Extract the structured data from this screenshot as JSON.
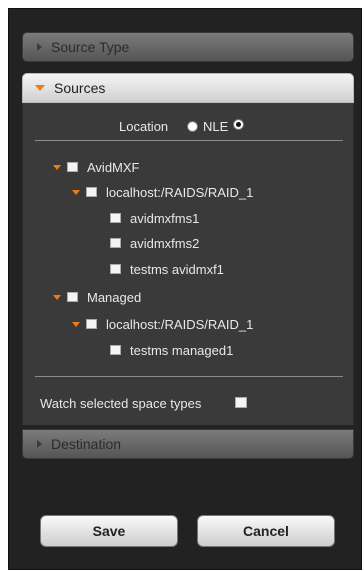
{
  "source_type": {
    "label": "Source Type",
    "expanded": false
  },
  "sources": {
    "label": "Sources",
    "expanded": true,
    "location_label": "Location",
    "nle_label": "NLE",
    "selected": "NLE",
    "tree": [
      {
        "label": "AvidMXF",
        "expanded": true
      },
      {
        "label": "localhost:/RAIDS/RAID_1",
        "expanded": true
      },
      {
        "label": "avidmxfms1"
      },
      {
        "label": "avidmxfms2"
      },
      {
        "label": "testms avidmxf1"
      },
      {
        "label": "Managed",
        "expanded": true
      },
      {
        "label": "localhost:/RAIDS/RAID_1",
        "expanded": true
      },
      {
        "label": "testms managed1"
      }
    ],
    "watch_label": "Watch selected space types",
    "watch_checked": false
  },
  "destination": {
    "label": "Destination",
    "expanded": false
  },
  "buttons": {
    "save": "Save",
    "cancel": "Cancel"
  },
  "colors": {
    "accent": "#ef7d10",
    "panel_bg": "#222222",
    "body_bg": "#3a3a3a"
  }
}
